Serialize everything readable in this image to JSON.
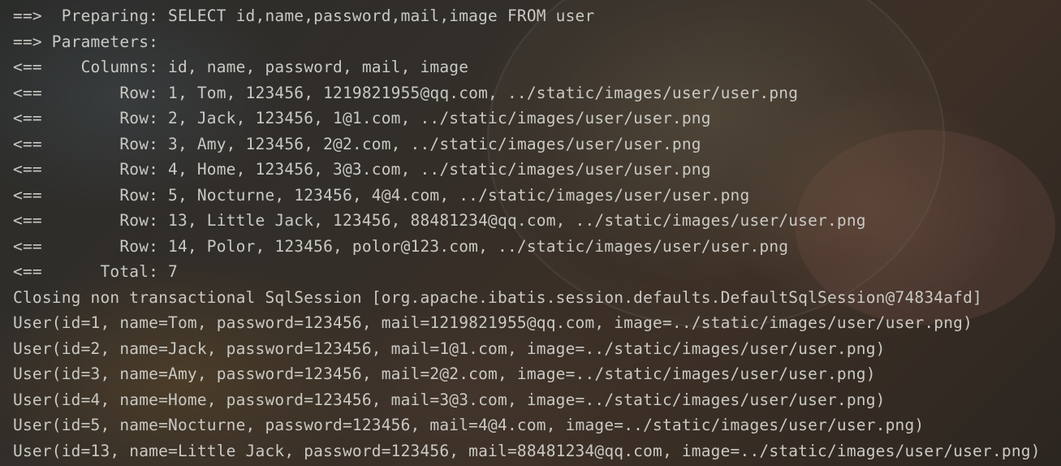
{
  "console": {
    "lines": [
      "==>  Preparing: SELECT id,name,password,mail,image FROM user",
      "==> Parameters: ",
      "<==    Columns: id, name, password, mail, image",
      "<==        Row: 1, Tom, 123456, 1219821955@qq.com, ../static/images/user/user.png",
      "<==        Row: 2, Jack, 123456, 1@1.com, ../static/images/user/user.png",
      "<==        Row: 3, Amy, 123456, 2@2.com, ../static/images/user/user.png",
      "<==        Row: 4, Home, 123456, 3@3.com, ../static/images/user/user.png",
      "<==        Row: 5, Nocturne, 123456, 4@4.com, ../static/images/user/user.png",
      "<==        Row: 13, Little Jack, 123456, 88481234@qq.com, ../static/images/user/user.png",
      "<==        Row: 14, Polor, 123456, polor@123.com, ../static/images/user/user.png",
      "<==      Total: 7",
      "Closing non transactional SqlSession [org.apache.ibatis.session.defaults.DefaultSqlSession@74834afd]",
      "User(id=1, name=Tom, password=123456, mail=1219821955@qq.com, image=../static/images/user/user.png)",
      "User(id=2, name=Jack, password=123456, mail=1@1.com, image=../static/images/user/user.png)",
      "User(id=3, name=Amy, password=123456, mail=2@2.com, image=../static/images/user/user.png)",
      "User(id=4, name=Home, password=123456, mail=3@3.com, image=../static/images/user/user.png)",
      "User(id=5, name=Nocturne, password=123456, mail=4@4.com, image=../static/images/user/user.png)",
      "User(id=13, name=Little Jack, password=123456, mail=88481234@qq.com, image=../static/images/user/user.png)"
    ]
  }
}
